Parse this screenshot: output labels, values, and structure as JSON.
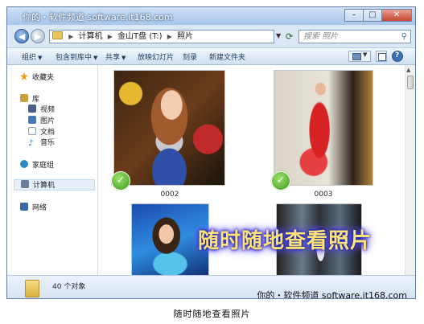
{
  "window": {
    "watermark_top": "你的・软件频道 software.it168.com",
    "buttons": {
      "minimize": "–",
      "maximize": "□",
      "close": "✕"
    }
  },
  "address": {
    "back_icon": "back-arrow-icon",
    "forward_icon": "forward-arrow-icon",
    "crumbs": [
      "计算机",
      "金山T盘 (T:)",
      "照片"
    ],
    "search_placeholder": "搜索 照片"
  },
  "toolbar": {
    "organize": "组织",
    "include_in_library": "包含到库中",
    "share": "共享",
    "slideshow": "放映幻灯片",
    "burn": "刻录",
    "new_folder": "新建文件夹",
    "help": "?"
  },
  "sidebar": {
    "items": [
      {
        "label": "收藏夹",
        "icon": "star-icon",
        "color": "#e8a11a"
      },
      {
        "label": "库",
        "icon": "library-icon",
        "color": "#c9a13a"
      },
      {
        "label": "视频",
        "icon": "video-icon",
        "color": "#4a5f8a"
      },
      {
        "label": "图片",
        "icon": "pictures-icon",
        "color": "#4a7ab4"
      },
      {
        "label": "文档",
        "icon": "documents-icon",
        "color": "#8aa0bd"
      },
      {
        "label": "音乐",
        "icon": "music-icon",
        "color": "#2a6ac0"
      },
      {
        "label": "家庭组",
        "icon": "homegroup-icon",
        "color": "#2e8ac6"
      },
      {
        "label": "计算机",
        "icon": "computer-icon",
        "color": "#6a7e98"
      },
      {
        "label": "网络",
        "icon": "network-icon",
        "color": "#3b6aa8"
      }
    ]
  },
  "files": [
    {
      "name": "0002",
      "checked": true
    },
    {
      "name": "0003",
      "checked": true
    },
    {
      "name": "",
      "checked": false
    },
    {
      "name": "",
      "checked": false
    }
  ],
  "overlay_text": "随时随地查看照片",
  "details": {
    "object_count": "40 个对象",
    "watermark_bottom": "你的・软件频道 software.it168.com"
  },
  "page_caption": "随时随地查看照片",
  "colors": {
    "accent": "#3b6fb6",
    "overlay_text": "#ffe27a",
    "check_green": "#3e9a1c"
  }
}
